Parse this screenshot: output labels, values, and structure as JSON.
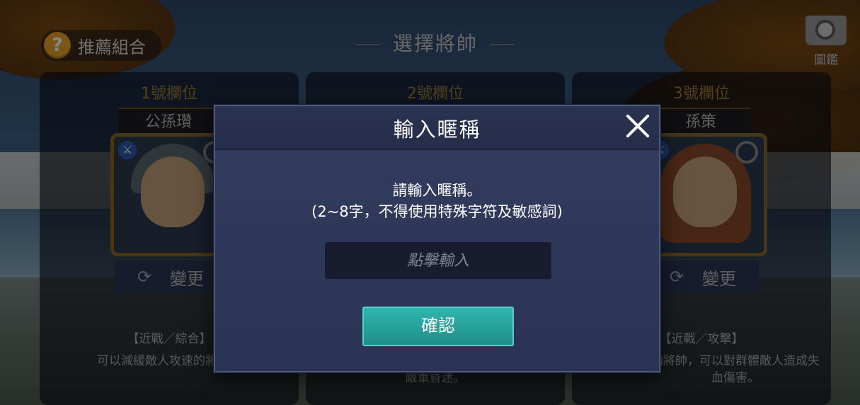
{
  "header": {
    "help_label": "推薦組合",
    "title": "選擇將帥",
    "codex_label": "圖鑑"
  },
  "slots": [
    {
      "title": "1號欄位",
      "hero_name": "公孫瓚",
      "change_label": "變更",
      "tag": "【近戰／綜合】",
      "desc": "可以減緩敵人攻速的將帥。"
    },
    {
      "title": "2號欄位",
      "hero_name": "",
      "change_label": "",
      "tag": "",
      "desc": "敵軍昏迷。"
    },
    {
      "title": "3號欄位",
      "hero_name": "孫策",
      "change_label": "變更",
      "tag": "【近戰／攻擊】",
      "desc": "的將帥，可以對群體敵人造成失血傷害。"
    }
  ],
  "modal": {
    "title": "輸入暱稱",
    "prompt_line1": "請輸入暱稱。",
    "prompt_line2": "(2~8字，不得使用特殊字符及敏感詞)",
    "input_placeholder": "點擊輸入",
    "input_value": "",
    "confirm_label": "確認"
  },
  "colors": {
    "accent_teal": "#2fb5ad",
    "slot_title_gold": "#9c7b39",
    "help_orange": "#e8a52a"
  }
}
